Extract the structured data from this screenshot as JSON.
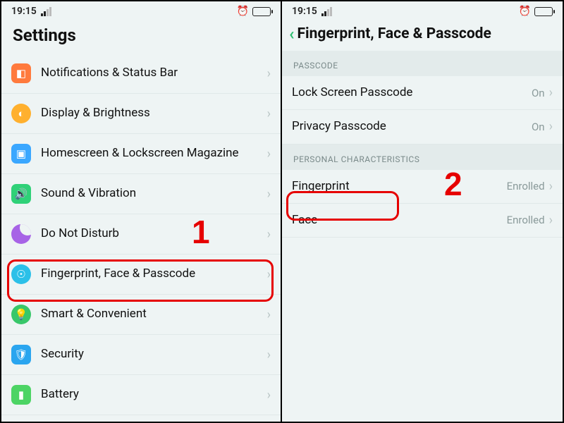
{
  "status": {
    "time": "19:15"
  },
  "left": {
    "title": "Settings",
    "items": [
      {
        "label": "Notifications & Status Bar"
      },
      {
        "label": "Display & Brightness"
      },
      {
        "label": "Homescreen & Lockscreen Magazine"
      },
      {
        "label": "Sound & Vibration"
      },
      {
        "label": "Do Not Disturb"
      },
      {
        "label": "Fingerprint, Face & Passcode"
      },
      {
        "label": "Smart & Convenient"
      },
      {
        "label": "Security"
      },
      {
        "label": "Battery"
      }
    ]
  },
  "right": {
    "title": "Fingerprint, Face & Passcode",
    "sections": {
      "passcode": {
        "header": "PASSCODE",
        "items": [
          {
            "label": "Lock Screen Passcode",
            "value": "On"
          },
          {
            "label": "Privacy Passcode",
            "value": "On"
          }
        ]
      },
      "personal": {
        "header": "PERSONAL CHARACTERISTICS",
        "items": [
          {
            "label": "Fingerprint",
            "value": "Enrolled"
          },
          {
            "label": "Face",
            "value": "Enrolled"
          }
        ]
      }
    }
  },
  "annotations": {
    "num1": "1",
    "num2": "2"
  }
}
